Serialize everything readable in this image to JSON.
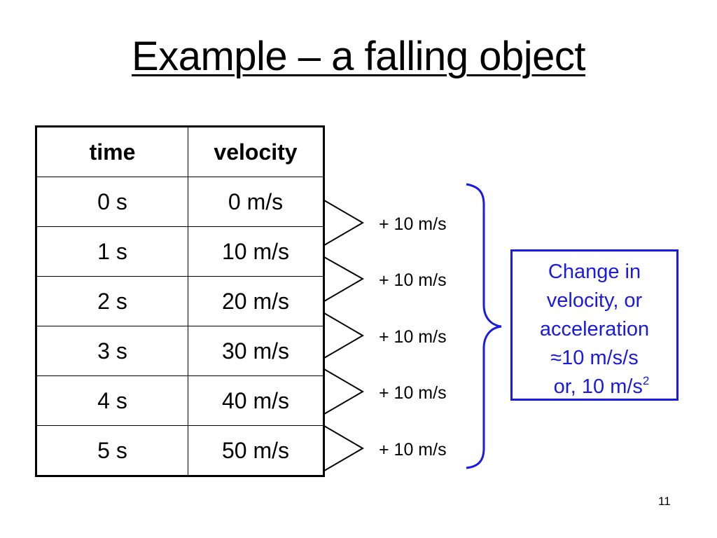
{
  "title": "Example – a falling object",
  "table": {
    "headers": [
      "time",
      "velocity"
    ],
    "rows": [
      [
        "0 s",
        "0 m/s"
      ],
      [
        "1 s",
        "10 m/s"
      ],
      [
        "2 s",
        "20 m/s"
      ],
      [
        "3 s",
        "30 m/s"
      ],
      [
        "4 s",
        "40 m/s"
      ],
      [
        "5 s",
        "50 m/s"
      ]
    ]
  },
  "differences": [
    "+ 10 m/s",
    "+ 10 m/s",
    "+ 10 m/s",
    "+ 10 m/s",
    "+ 10 m/s"
  ],
  "note": {
    "lines": [
      "Change in",
      "velocity, or",
      "acceleration",
      "≈10 m/s/s"
    ],
    "last_line_prefix": "or, 10 m/s",
    "last_line_superscript": "2"
  },
  "colors": {
    "accent": "#1a1ae6",
    "text": "#000000"
  },
  "page_number": "11"
}
